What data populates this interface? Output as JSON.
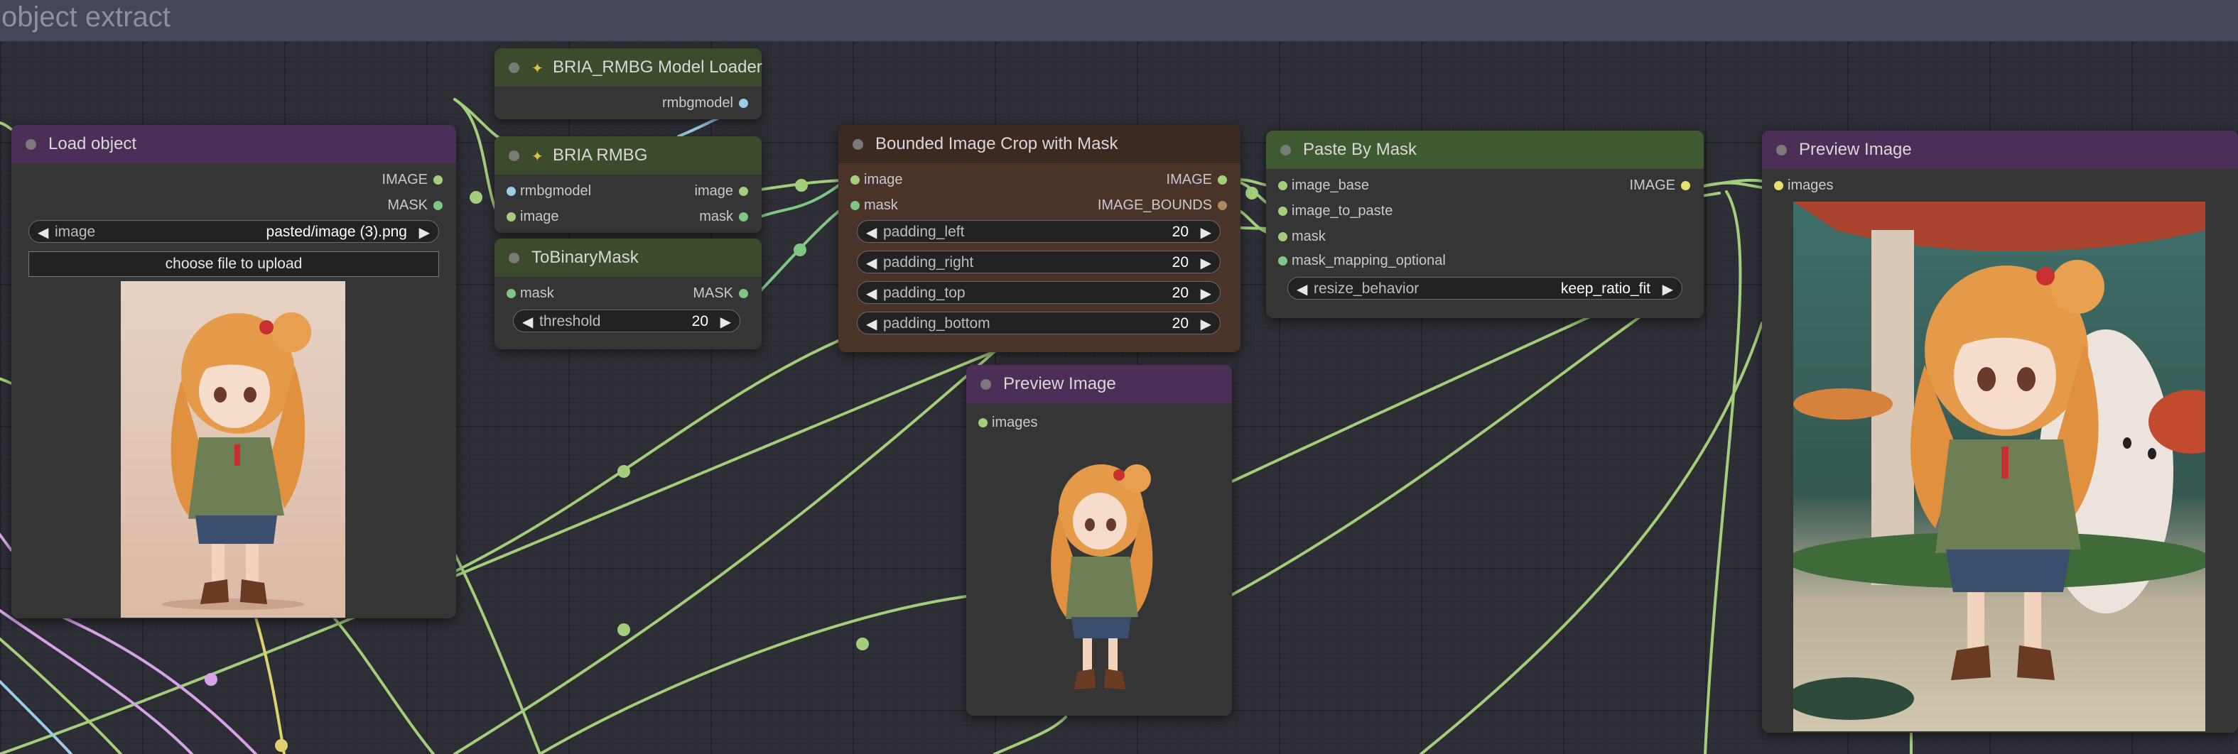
{
  "group": {
    "title": "object extract"
  },
  "colors": {
    "background": "#2b2c30",
    "node_body": "#353535",
    "header_purple": "#4c2f58",
    "header_green_dark": "#3b4b2c",
    "header_green": "#3f5a30",
    "header_brown": "#5a3d2c",
    "body_brown": "#4a342a",
    "wire_image": "#a3ce7c",
    "wire_mask": "#81c784",
    "wire_model": "#9ecbe8",
    "wire_misc": "#d6a2e8"
  },
  "nodes": {
    "load_object": {
      "title": "Load object",
      "outputs": [
        "IMAGE",
        "MASK"
      ],
      "image_widget": {
        "name": "image",
        "value": "pasted/image (3).png"
      },
      "upload_label": "choose file to upload"
    },
    "model_loader": {
      "title": "BRIA_RMBG Model Loader",
      "output": "rmbgmodel",
      "icon": "wand-icon"
    },
    "bria_rmbg": {
      "title": "BRIA RMBG",
      "icon": "wand-icon",
      "inputs": [
        "rmbgmodel",
        "image"
      ],
      "outputs": [
        "image",
        "mask"
      ]
    },
    "to_binary_mask": {
      "title": "ToBinaryMask",
      "input": "mask",
      "output": "MASK",
      "threshold": {
        "name": "threshold",
        "value": "20"
      }
    },
    "bounded_crop": {
      "title": "Bounded Image Crop with Mask",
      "inputs": [
        "image",
        "mask"
      ],
      "outputs": [
        "IMAGE",
        "IMAGE_BOUNDS"
      ],
      "widgets": [
        {
          "name": "padding_left",
          "value": "20"
        },
        {
          "name": "padding_right",
          "value": "20"
        },
        {
          "name": "padding_top",
          "value": "20"
        },
        {
          "name": "padding_bottom",
          "value": "20"
        }
      ]
    },
    "preview_small": {
      "title": "Preview Image",
      "input": "images"
    },
    "paste_by_mask": {
      "title": "Paste By Mask",
      "inputs": [
        "image_base",
        "image_to_paste",
        "mask",
        "mask_mapping_optional"
      ],
      "output": "IMAGE",
      "resize": {
        "name": "resize_behavior",
        "value": "keep_ratio_fit"
      }
    },
    "preview_large": {
      "title": "Preview Image",
      "input": "images"
    }
  }
}
